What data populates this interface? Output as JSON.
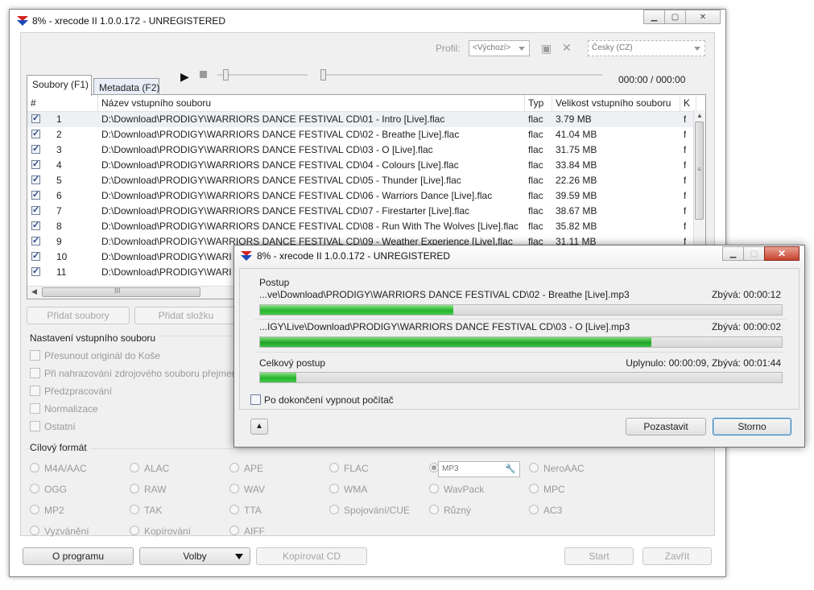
{
  "main": {
    "title": "8% - xrecode II 1.0.0.172 - UNREGISTERED",
    "profile_label": "Profil:",
    "profile_value": "<Výchozí>",
    "language_value": "Česky (CZ)",
    "time_display": "000:00 / 000:00",
    "tabs": [
      {
        "label": "Soubory (F1)"
      },
      {
        "label": "Metadata (F2)"
      }
    ],
    "columns": [
      "#",
      "Název vstupního souboru",
      "Typ",
      "Velikost vstupního souboru",
      "K"
    ],
    "rows": [
      {
        "num": "1",
        "name": "D:\\Download\\PRODIGY\\WARRIORS DANCE FESTIVAL CD\\01 - Intro [Live].flac",
        "type": "flac",
        "size": "3.79 MB",
        "extra": "f"
      },
      {
        "num": "2",
        "name": "D:\\Download\\PRODIGY\\WARRIORS DANCE FESTIVAL CD\\02 - Breathe [Live].flac",
        "type": "flac",
        "size": "41.04 MB",
        "extra": "f"
      },
      {
        "num": "3",
        "name": "D:\\Download\\PRODIGY\\WARRIORS DANCE FESTIVAL CD\\03 - O [Live].flac",
        "type": "flac",
        "size": "31.75 MB",
        "extra": "f"
      },
      {
        "num": "4",
        "name": "D:\\Download\\PRODIGY\\WARRIORS DANCE FESTIVAL CD\\04 - Colours [Live].flac",
        "type": "flac",
        "size": "33.84 MB",
        "extra": "f"
      },
      {
        "num": "5",
        "name": "D:\\Download\\PRODIGY\\WARRIORS DANCE FESTIVAL CD\\05 - Thunder [Live].flac",
        "type": "flac",
        "size": "22.26 MB",
        "extra": "f"
      },
      {
        "num": "6",
        "name": "D:\\Download\\PRODIGY\\WARRIORS DANCE FESTIVAL CD\\06 - Warriors Dance [Live].flac",
        "type": "flac",
        "size": "39.59 MB",
        "extra": "f"
      },
      {
        "num": "7",
        "name": "D:\\Download\\PRODIGY\\WARRIORS DANCE FESTIVAL CD\\07 - Firestarter [Live].flac",
        "type": "flac",
        "size": "38.67 MB",
        "extra": "f"
      },
      {
        "num": "8",
        "name": "D:\\Download\\PRODIGY\\WARRIORS DANCE FESTIVAL CD\\08 - Run With The Wolves [Live].flac",
        "type": "flac",
        "size": "35.82 MB",
        "extra": "f"
      },
      {
        "num": "9",
        "name": "D:\\Download\\PRODIGY\\WARRIORS DANCE FESTIVAL CD\\09 - Weather Experience [Live].flac",
        "type": "flac",
        "size": "31.11 MB",
        "extra": "f"
      },
      {
        "num": "10",
        "name": "D:\\Download\\PRODIGY\\WARI",
        "type": "",
        "size": "",
        "extra": "f"
      },
      {
        "num": "11",
        "name": "D:\\Download\\PRODIGY\\WARI",
        "type": "",
        "size": "",
        "extra": "f"
      }
    ],
    "hscroll_grip": "III",
    "add_files": "Přidat soubory",
    "add_folder": "Přidat složku",
    "input_settings_title": "Nastavení vstupního souboru",
    "input_options": [
      "Přesunout originál do Koše",
      "Při nahrazování zdrojového souboru přejmen",
      "Předzpracování",
      "Normalizace",
      "Ostatní"
    ],
    "target_title": "Cílový formát",
    "formats": [
      [
        "M4A/AAC",
        "ALAC",
        "APE",
        "FLAC",
        "MP3",
        "NeroAAC"
      ],
      [
        "OGG",
        "RAW",
        "WAV",
        "WMA",
        "WavPack",
        "MPC"
      ],
      [
        "MP2",
        "TAK",
        "TTA",
        "Spojování/CUE",
        "Různý",
        "AC3"
      ],
      [
        "Vyzvánění",
        "Kopírování",
        "AIFF"
      ]
    ],
    "selected_format": "MP3",
    "about": "O programu",
    "options": "Volby",
    "rip_cd": "Kopírovat CD",
    "start": "Start",
    "close": "Zavřít"
  },
  "dialog": {
    "title": "8% - xrecode II 1.0.0.172 - UNREGISTERED",
    "progress_label": "Postup",
    "job1_path": "...ve\\Download\\PRODIGY\\WARRIORS DANCE FESTIVAL CD\\02 - Breathe [Live].mp3",
    "job1_remaining": "Zbývá: 00:00:12",
    "job1_progress": 0.37,
    "job2_path": "...IGY\\Live\\Download\\PRODIGY\\WARRIORS DANCE FESTIVAL CD\\03 - O [Live].mp3",
    "job2_remaining": "Zbývá: 00:00:02",
    "job2_progress": 0.75,
    "total_label": "Celkový postup",
    "total_time": "Uplynulo: 00:00:09, Zbývá: 00:01:44",
    "total_progress": 0.07,
    "shutdown_label": "Po dokončení vypnout počítač",
    "pause": "Pozastavit",
    "cancel": "Storno"
  }
}
